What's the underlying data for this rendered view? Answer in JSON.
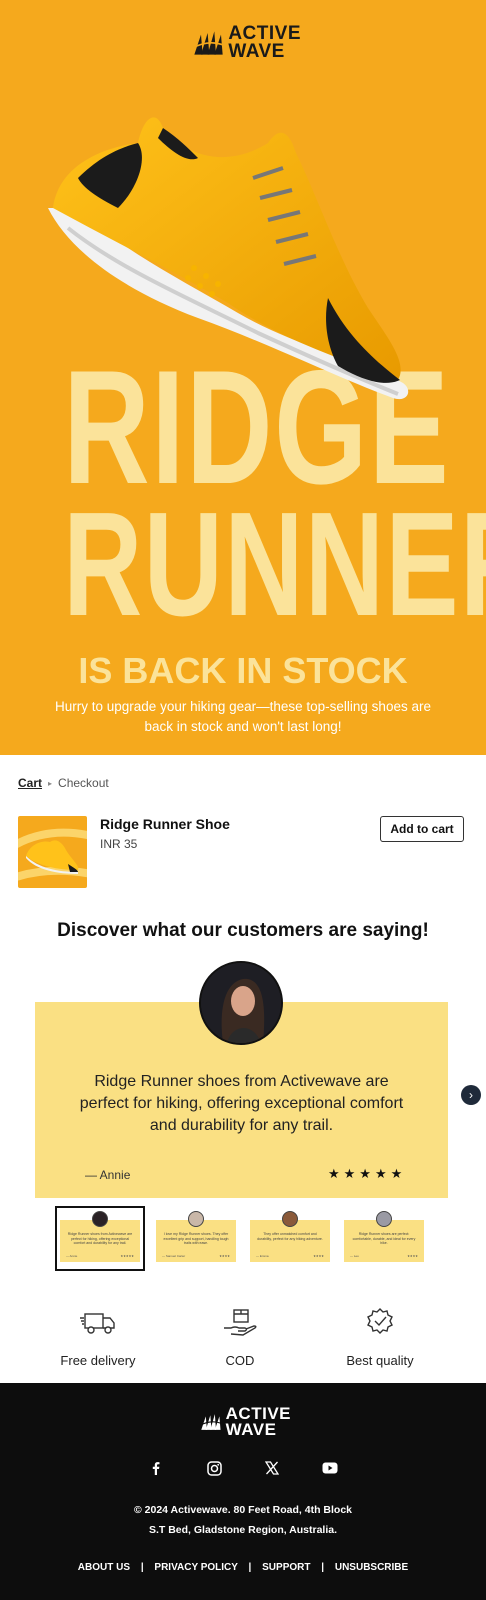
{
  "brand": {
    "line1": "ACTIVE",
    "line2": "WAVE"
  },
  "hero": {
    "word1": "RIDGE",
    "word2": "RUNNER",
    "subtitle": "IS BACK IN STOCK",
    "description": "Hurry to upgrade your hiking gear—these top-selling shoes are back in stock and won't last long!"
  },
  "breadcrumb": {
    "cart": "Cart",
    "separator": "▸",
    "checkout": "Checkout"
  },
  "product": {
    "name": "Ridge Runner Shoe",
    "price": "INR 35",
    "button": "Add to cart"
  },
  "testimonials": {
    "title": "Discover what our customers are saying!",
    "quote": "Ridge Runner shoes from Activewave are perfect for hiking, offering exceptional comfort and durability for any trail.",
    "author": "— Annie",
    "stars": "★★★★★",
    "next": "›",
    "thumbs": [
      {
        "text": "Ridge Runner shoes from Activewave are perfect for hiking, offering exceptional comfort and durability for any trail.",
        "author": "— Annie",
        "stars": "★★★★★"
      },
      {
        "text": "I love my Ridge Runner shoes. They offer excellent grip and support, handling tough trails with ease.",
        "author": "— Samuel Carter",
        "stars": "★★★★"
      },
      {
        "text": "They offer unmatched comfort and durability, perfect for any hiking adventure.",
        "author": "— Emma",
        "stars": "★★★★"
      },
      {
        "text": "Ridge Runner shoes are perfect: comfortable, durable, and ideal for every hike.",
        "author": "— Leo",
        "stars": "★★★★"
      }
    ]
  },
  "features": [
    {
      "label": "Free delivery",
      "icon": "truck-icon"
    },
    {
      "label": "COD",
      "icon": "package-hand-icon"
    },
    {
      "label": "Best quality",
      "icon": "quality-badge-icon"
    }
  ],
  "footer": {
    "copyright": "© 2024 Activewave. 80 Feet Road, 4th Block",
    "address": "S.T Bed, Gladstone Region, Australia.",
    "links": [
      "ABOUT US",
      "PRIVACY POLICY",
      "SUPPORT",
      "UNSUBSCRIBE"
    ],
    "separator": "|"
  },
  "colors": {
    "hero_bg": "#F5A91D",
    "hero_text": "#FBE39A",
    "card_bg": "#FAE083",
    "footer_bg": "#0d0d0d"
  }
}
